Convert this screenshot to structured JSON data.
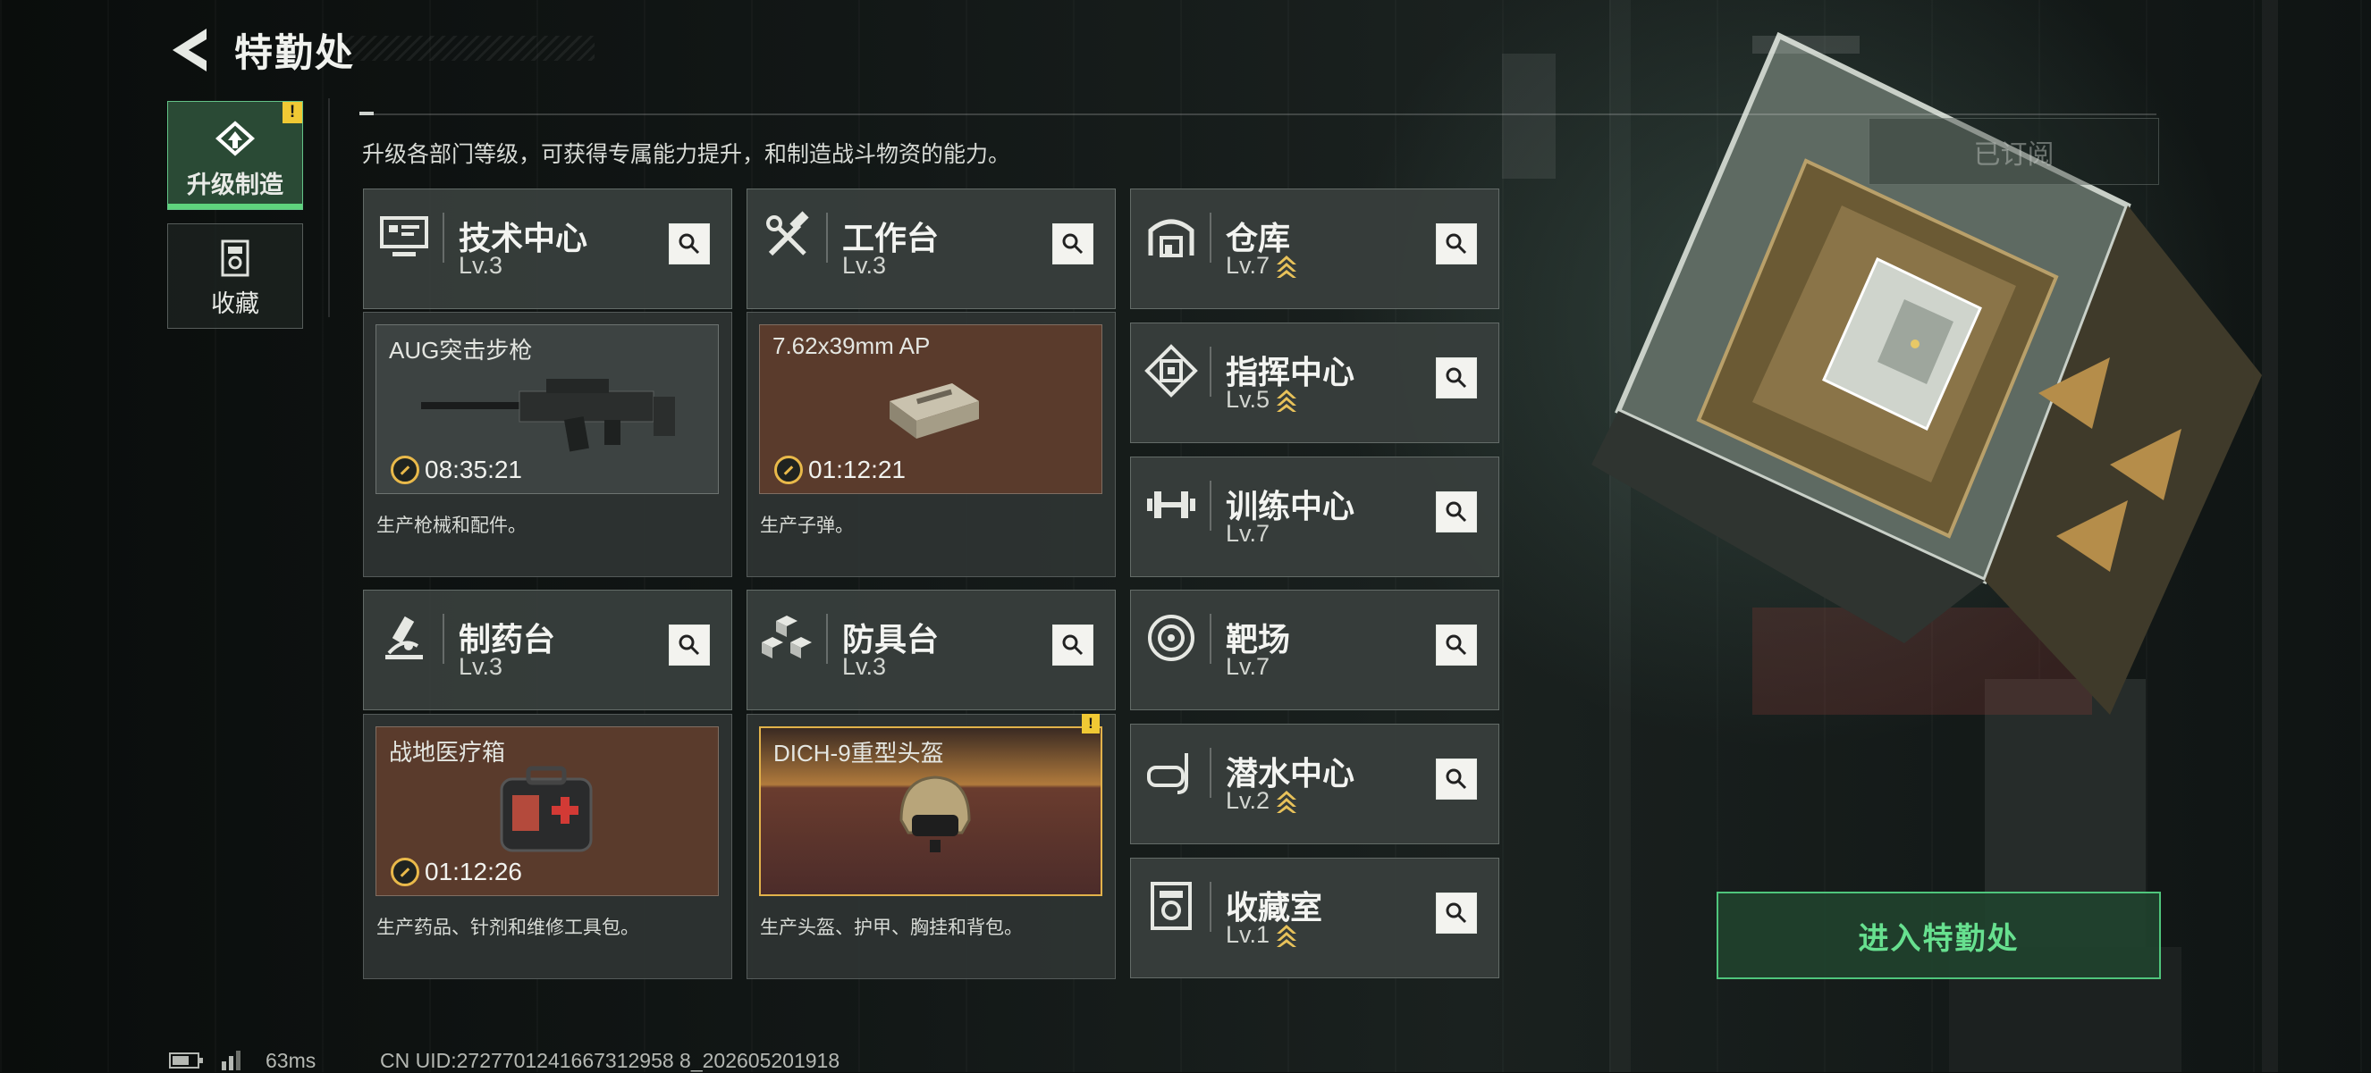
{
  "header": {
    "title": "特勤处",
    "subtitle": "升级各部门等级，可获得专属能力提升，和制造战斗物资的能力。"
  },
  "tabs": [
    {
      "label": "升级制造",
      "active": true,
      "alert": "!"
    },
    {
      "label": "收藏",
      "active": false
    }
  ],
  "stations": {
    "tech": {
      "name": "技术中心",
      "level": "Lv.3",
      "product": "AUG突击步枪",
      "timer": "08:35:21",
      "desc": "生产枪械和配件。"
    },
    "workbench": {
      "name": "工作台",
      "level": "Lv.3",
      "product": "7.62x39mm AP",
      "timer": "01:12:21",
      "desc": "生产子弹。"
    },
    "pharmacy": {
      "name": "制药台",
      "level": "Lv.3",
      "product": "战地医疗箱",
      "timer": "01:12:26",
      "desc": "生产药品、针剂和维修工具包。"
    },
    "armor": {
      "name": "防具台",
      "level": "Lv.3",
      "product": "DICH-9重型头盔",
      "alert": "!",
      "desc": "生产头盔、护甲、胸挂和背包。"
    }
  },
  "facilities": [
    {
      "name": "仓库",
      "level": "Lv.7",
      "upgrade": true
    },
    {
      "name": "指挥中心",
      "level": "Lv.5",
      "upgrade": true
    },
    {
      "name": "训练中心",
      "level": "Lv.7",
      "upgrade": false
    },
    {
      "name": "靶场",
      "level": "Lv.7",
      "upgrade": false
    },
    {
      "name": "潜水中心",
      "level": "Lv.2",
      "upgrade": true
    },
    {
      "name": "收藏室",
      "level": "Lv.1",
      "upgrade": true
    }
  ],
  "buttons": {
    "subscribed": "已订阅",
    "enter": "进入特勤处"
  },
  "status": {
    "ping": "63ms",
    "uid": "CN UID:2727701241667312958 8_202605201918"
  },
  "colors": {
    "accent_green": "#5fd37d",
    "alert_yellow": "#f0c934",
    "timer_gold": "#e9b94a"
  }
}
